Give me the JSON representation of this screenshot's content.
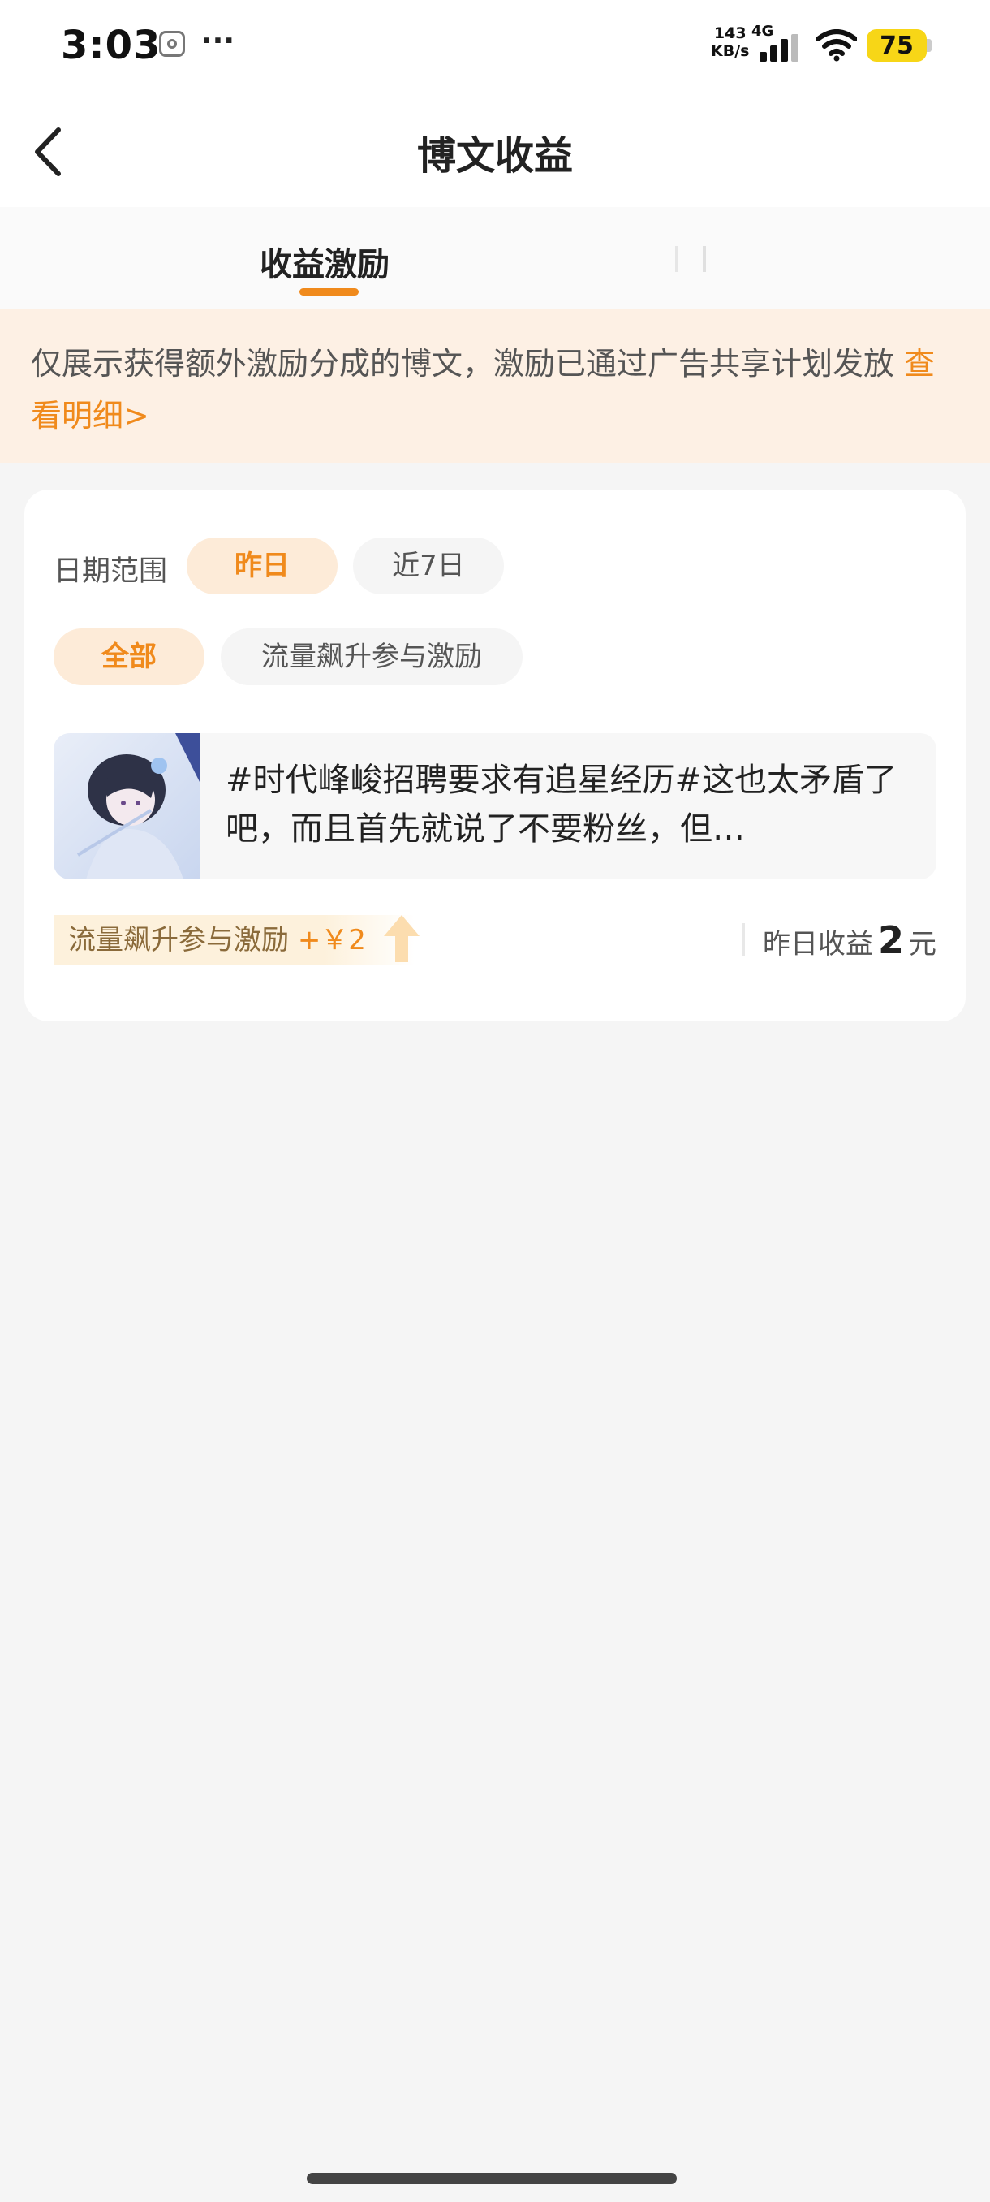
{
  "status_bar": {
    "time": "3:03",
    "more": "···",
    "net_speed_value": "143",
    "net_speed_unit": "KB/s",
    "network": "4G",
    "battery": "75"
  },
  "nav": {
    "title": "博文收益"
  },
  "tabs": {
    "active_label": "收益激励"
  },
  "notice": {
    "text": "仅展示获得额外激励分成的博文，激励已通过广告共享计划发放 ",
    "link": "查看明细>"
  },
  "filters": {
    "date_label": "日期范围",
    "date_options": [
      "昨日",
      "近7日"
    ],
    "type_options": [
      "全部",
      "流量飙升参与激励"
    ]
  },
  "article": {
    "text": "#时代峰峻招聘要求有追星经历#这也太矛盾了吧，而且首先就说了不要粉丝，但…"
  },
  "reward": {
    "label": "流量飙升参与激励",
    "amount": "+￥2"
  },
  "yield": {
    "label": "昨日收益",
    "value": "2",
    "unit": "元"
  },
  "colors": {
    "accent": "#f08a1c",
    "notice_bg": "#fdf0e4",
    "chip_active_bg": "#fdebd8"
  }
}
